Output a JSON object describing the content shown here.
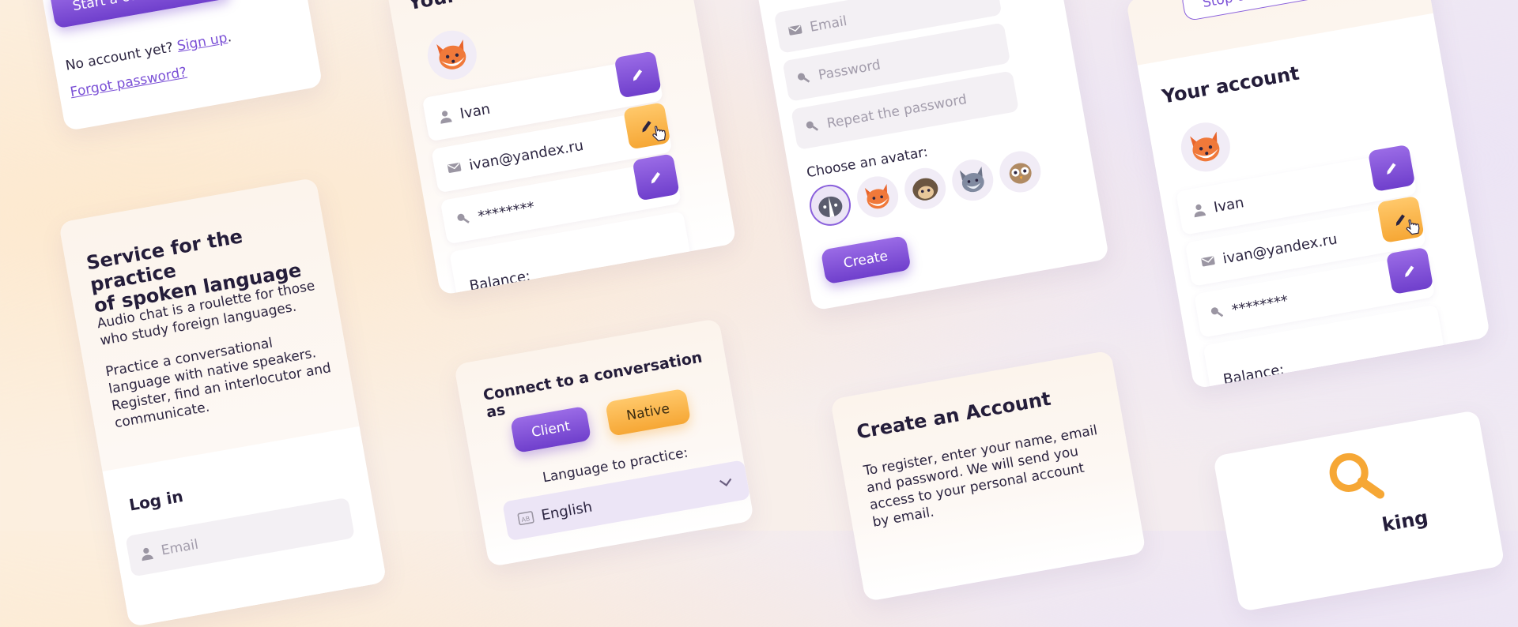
{
  "login_top": {
    "start_button": "Start a conversation",
    "no_account_text": "No account yet?",
    "signup_link": "Sign up",
    "signup_period": ".",
    "forgot_link": "Forgot password?"
  },
  "service_card": {
    "title_line1": "Service for the practice",
    "title_line2": "of spoken language",
    "para1_line1": "Audio chat is a roulette for those",
    "para1_line2": "who study foreign languages.",
    "para2_line1": "Practice a conversational",
    "para2_line2": "language with native speakers.",
    "para2_line3": "Register, find an interlocutor and",
    "para2_line4": "communicate.",
    "login_title": "Log in",
    "email_placeholder": "Email"
  },
  "account_card_1": {
    "title": "Your account",
    "name": "Ivan",
    "email": "ivan@yandex.ru",
    "password": "********",
    "balance_label": "Balance:"
  },
  "connect_card": {
    "title": "Connect to a conversation as",
    "client_button": "Client",
    "native_button": "Native",
    "language_label": "Language to practice:",
    "language_value": "English"
  },
  "register_form": {
    "email_placeholder": "Email",
    "password_placeholder": "Password",
    "repeat_placeholder": "Repeat the password",
    "avatar_label": "Choose an avatar:",
    "avatars": [
      "badger",
      "fox",
      "hedgehog",
      "wolf",
      "owl"
    ],
    "create_button": "Create"
  },
  "create_account_card": {
    "title": "Create an Account",
    "line1": "To register, enter your name, email",
    "line2": "and password. We will send you",
    "line3": "access to your personal account",
    "line4": "by email."
  },
  "account_card_2": {
    "stop_button": "Stop the search",
    "title": "Your account",
    "name": "Ivan",
    "email": "ivan@yandex.ru",
    "password": "********",
    "balance_label": "Balance:"
  },
  "searching_card": {
    "partial_text": "king"
  },
  "colors": {
    "primary_purple": "#7a4fd6",
    "accent_orange": "#f6a735",
    "heading": "#241d3a"
  }
}
